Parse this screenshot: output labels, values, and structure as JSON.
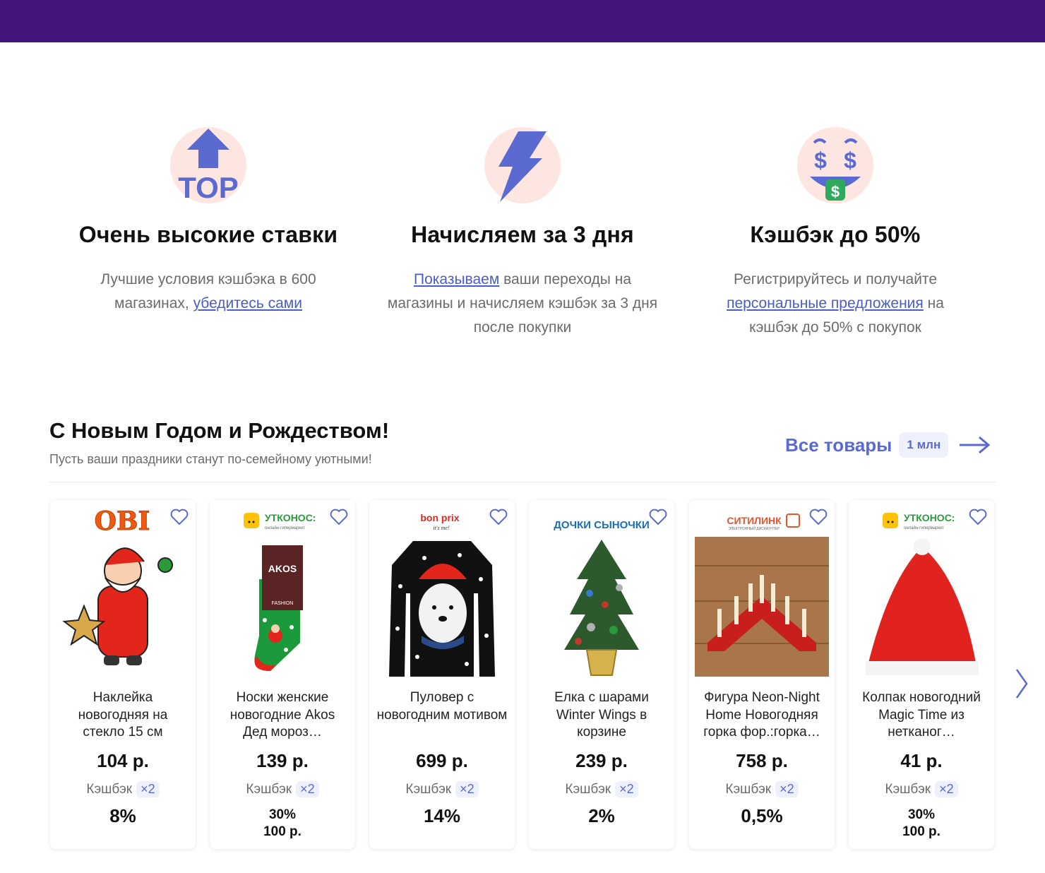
{
  "features": [
    {
      "icon": "top-arrow-icon",
      "icon_text": "TOP",
      "title": "Очень высокие ставки",
      "text_before": "Лучшие условия кэшбэка в 600 магазинах, ",
      "link": "убедитесь сами",
      "text_after": ""
    },
    {
      "icon": "lightning-icon",
      "title": "Начисляем за 3 дня",
      "text_before": "",
      "link": "Показываем",
      "text_after": " ваши переходы на магазины и начисляем кэшбэк за 3 дня после покупки"
    },
    {
      "icon": "money-face-icon",
      "title": "Кэшбэк до 50%",
      "text_before": "Регистрируйтесь и получайте ",
      "link": "персональные предложения",
      "text_after": " на кэшбэк до 50% с покупок"
    }
  ],
  "section": {
    "title": "С Новым Годом и Рождеством!",
    "subtitle": "Пусть ваши праздники станут по-семейному уютными!",
    "all_label": "Все товары",
    "all_count": "1 млн"
  },
  "colors": {
    "topbar": "#45167a",
    "accent": "#5b6ad1",
    "badge_bg": "#eef0fb"
  },
  "products": [
    {
      "store": "OBI",
      "store_sub": "",
      "image": "santa-sticker",
      "name": "Наклейка новогодняя на стекло 15 см",
      "price": "104 р.",
      "cashback_label": "Кэшбэк",
      "multiplier": "×2",
      "cashback": "8%",
      "cashback_extra": ""
    },
    {
      "store": "УТКОНОС:",
      "store_sub": "онлайн-гипермаркет",
      "image": "christmas-socks",
      "name": "Носки женские новогодние Akos Дед мороз…",
      "price": "139 р.",
      "cashback_label": "Кэшбэк",
      "multiplier": "×2",
      "cashback": "30%",
      "cashback_extra": "100 р."
    },
    {
      "store": "bon prix",
      "store_sub": "it's me!",
      "image": "bear-sweater",
      "name": "Пуловер с новогодним мотивом",
      "price": "699 р.",
      "cashback_label": "Кэшбэк",
      "multiplier": "×2",
      "cashback": "14%",
      "cashback_extra": ""
    },
    {
      "store": "ДОЧКИ СЫНОЧКИ",
      "store_sub": "",
      "image": "small-christmas-tree",
      "name": "Елка с шарами Winter Wings в корзине",
      "price": "239 р.",
      "cashback_label": "Кэшбэк",
      "multiplier": "×2",
      "cashback": "2%",
      "cashback_extra": ""
    },
    {
      "store": "СИТИЛИНК",
      "store_sub": "ЭЛЕКТРОННЫЙ ДИСКАУНТЕР",
      "image": "candle-bridge",
      "name": "Фигура Neon-Night Home Новогодняя горка фор.:горка…",
      "price": "758 р.",
      "cashback_label": "Кэшбэк",
      "multiplier": "×2",
      "cashback": "0,5%",
      "cashback_extra": ""
    },
    {
      "store": "УТКОНОС:",
      "store_sub": "онлайн-гипермаркет",
      "image": "santa-hat",
      "name": "Колпак новогодний Magic Time из нетканог…",
      "price": "41 р.",
      "cashback_label": "Кэшбэк",
      "multiplier": "×2",
      "cashback": "30%",
      "cashback_extra": "100 р."
    }
  ]
}
